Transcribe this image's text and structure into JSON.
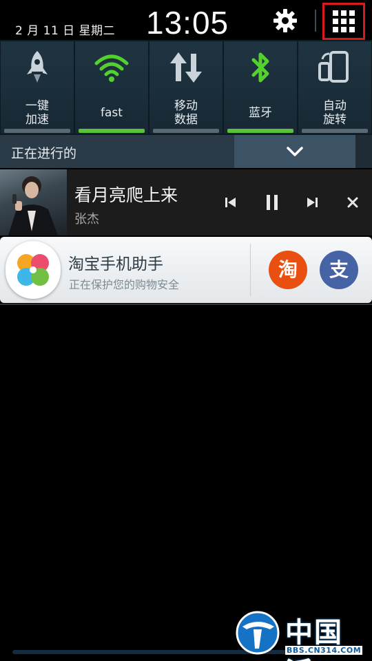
{
  "status": {
    "date": "2 月 11 日 星期二",
    "time": "13:05"
  },
  "toggles": [
    {
      "label": "一键\n加速",
      "line1": "一键",
      "line2": "加速",
      "icon": "rocket-icon",
      "on": false
    },
    {
      "label": "fast",
      "line1": "fast",
      "line2": "",
      "icon": "wifi-icon",
      "on": true
    },
    {
      "label": "移动\n数据",
      "line1": "移动",
      "line2": "数据",
      "icon": "mobile-data-icon",
      "on": false
    },
    {
      "label": "蓝牙",
      "line1": "蓝牙",
      "line2": "",
      "icon": "bluetooth-icon",
      "on": true
    },
    {
      "label": "自动\n旋转",
      "line1": "自动",
      "line2": "旋转",
      "icon": "auto-rotate-icon",
      "on": false
    }
  ],
  "colors": {
    "toggle_on": "#58c23a",
    "toggle_off": "#5a6a72",
    "highlight_box": "#d81a1a",
    "taobao": "#ea4f12",
    "alipay": "#4663a6"
  },
  "ongoing": {
    "label": "正在进行的"
  },
  "music": {
    "title": "看月亮爬上来",
    "artist": "张杰"
  },
  "taobao_notice": {
    "title": "淘宝手机助手",
    "subtitle": "正在保护您的购物安全",
    "button_taobao": "淘",
    "button_alipay": "支"
  },
  "watermark": {
    "brand": "中国派",
    "url": "BBS.CN314.COM"
  }
}
